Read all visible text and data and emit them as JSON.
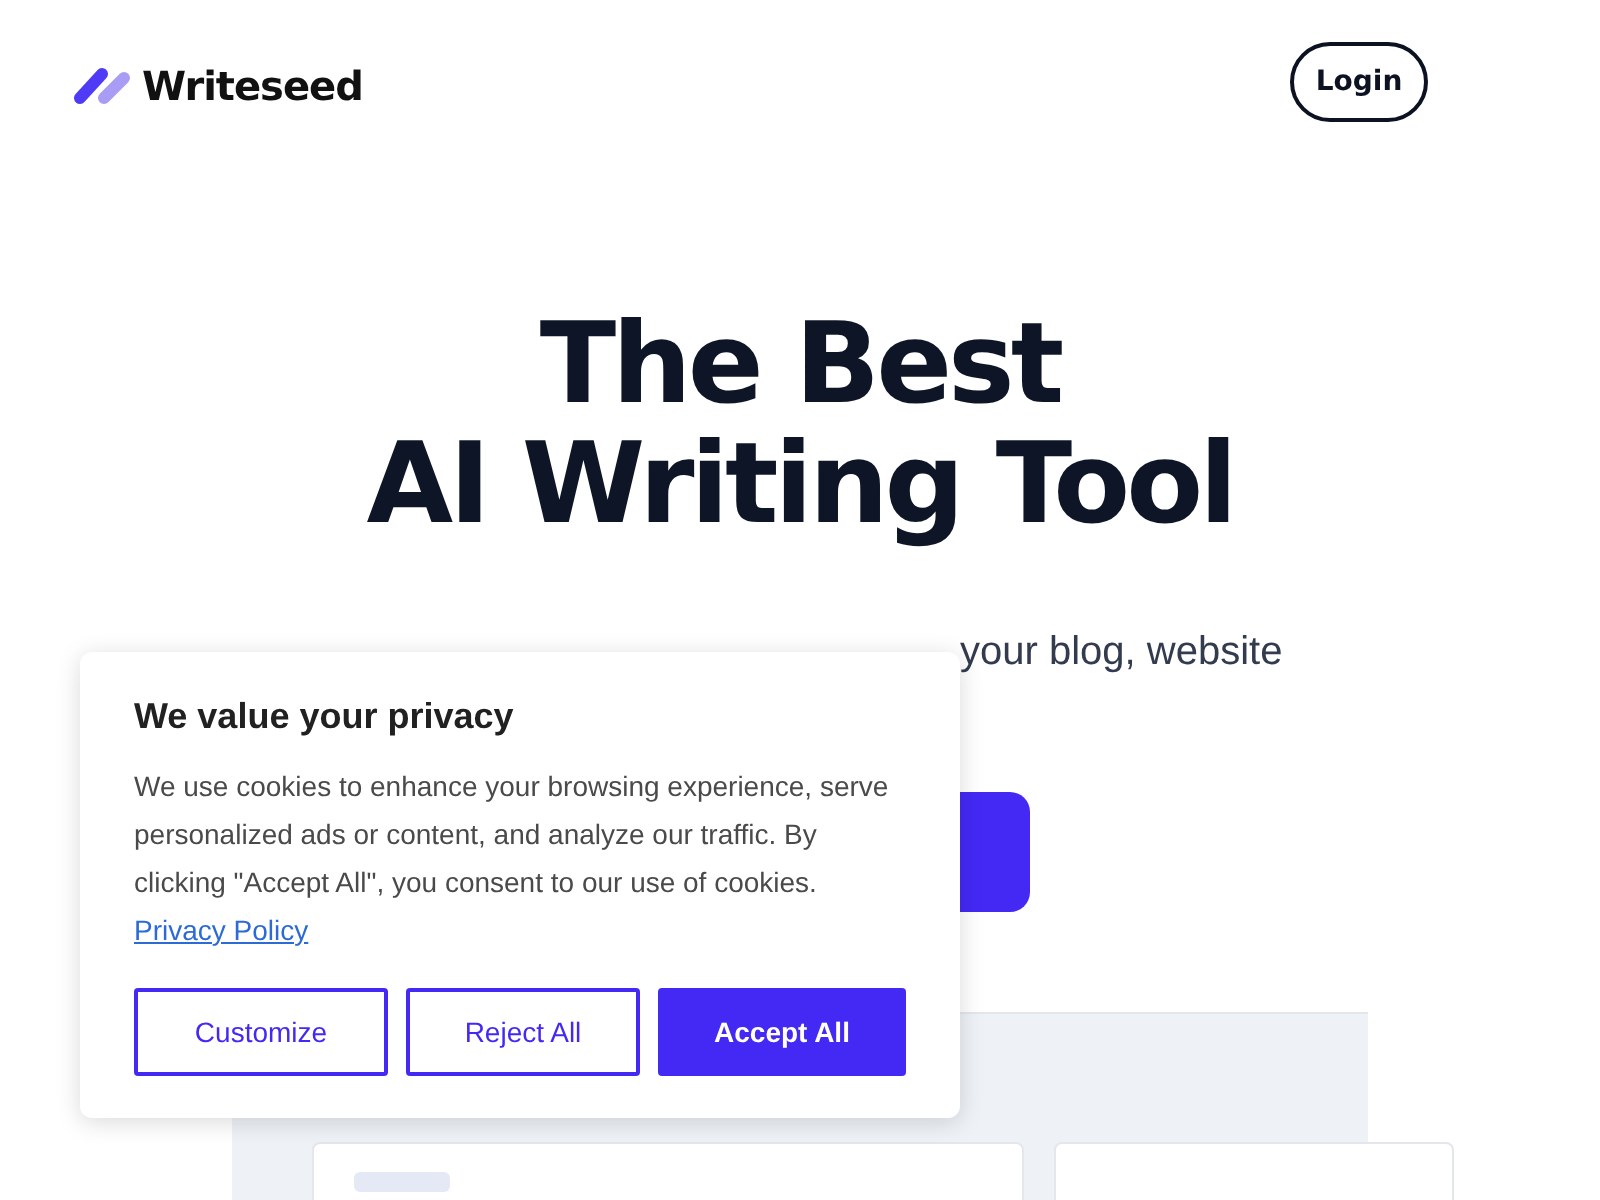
{
  "header": {
    "brand": "Writeseed",
    "login_button": "Login"
  },
  "hero": {
    "title_lines": [
      "The Best",
      "AI Writing Tool"
    ],
    "subtitle": "your blog, website"
  },
  "cookie_dialog": {
    "title": "We value your privacy",
    "body": "We use cookies to enhance your browsing experience, serve personalized ads or content, and analyze our traffic. By clicking \"Accept All\", you consent to our use of cookies.",
    "link": "Privacy Policy",
    "buttons": [
      {
        "label": "Customize",
        "kind": "outline"
      },
      {
        "label": "Reject All",
        "kind": "outline"
      },
      {
        "label": "Accept All",
        "kind": "primary"
      }
    ]
  }
}
